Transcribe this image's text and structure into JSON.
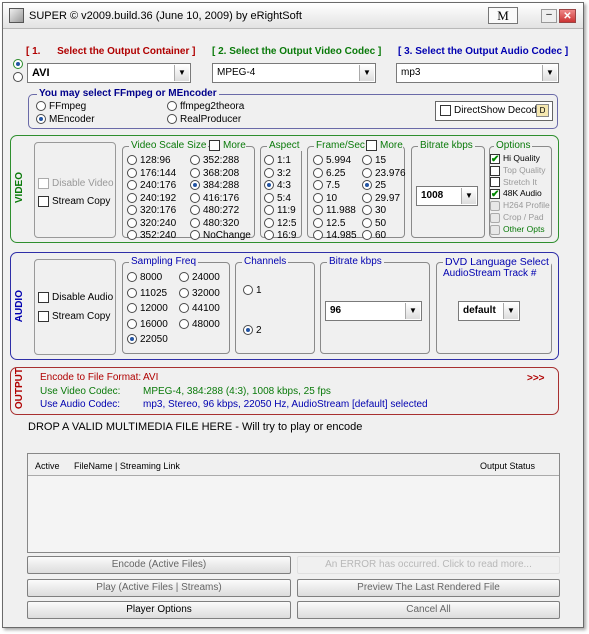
{
  "window": {
    "title": "SUPER © v2009.build.36 (June 10, 2009) by eRightSoft",
    "m_button": "M",
    "minimize": "–",
    "close": "✕"
  },
  "header": {
    "container_label": "Select the Output Container ]",
    "container_num": "[ 1.",
    "video_codec_label": "2.  Select the Output Video Codec ]",
    "video_codec_num": "[",
    "audio_codec_label": "3.  Select the Output Audio Codec ]",
    "audio_codec_num": "[",
    "container_value": "AVI",
    "video_codec_value": "MPEG-4",
    "audio_codec_value": "mp3"
  },
  "encoder": {
    "title": "You may select FFmpeg or MEncoder",
    "options": [
      "FFmpeg",
      "ffmpeg2theora",
      "MEncoder",
      "RealProducer"
    ],
    "selected": "MEncoder",
    "directshow": "DirectShow Decode"
  },
  "video": {
    "section": "VIDEO",
    "disable": "Disable Video",
    "stream_copy": "Stream Copy",
    "scale_title": "Video Scale Size",
    "scale_more": "More",
    "scale_col1": [
      "128:96",
      "176:144",
      "240:176",
      "240:192",
      "320:176",
      "320:240",
      "352:240"
    ],
    "scale_col2": [
      "352:288",
      "368:208",
      "384:288",
      "416:176",
      "480:272",
      "480:320",
      "NoChange"
    ],
    "scale_selected": "384:288",
    "aspect_title": "Aspect",
    "aspect": [
      "1:1",
      "3:2",
      "4:3",
      "5:4",
      "11:9",
      "12:5",
      "16:9"
    ],
    "aspect_selected": "4:3",
    "fps_title": "Frame/Sec",
    "fps_more": "More",
    "fps_col1": [
      "5.994",
      "6.25",
      "7.5",
      "10",
      "11.988",
      "12.5",
      "14.985"
    ],
    "fps_col2": [
      "15",
      "23.976",
      "25",
      "29.97",
      "30",
      "50",
      "60"
    ],
    "fps_selected": "25",
    "bitrate_title": "Bitrate  kbps",
    "bitrate_value": "1008",
    "options_title": "Options",
    "options": [
      "Hi Quality",
      "Top Quality",
      "Stretch It",
      "48K Audio",
      "H264 Profile",
      "Crop / Pad",
      "Other Opts"
    ]
  },
  "audio": {
    "section": "AUDIO",
    "disable": "Disable Audio",
    "stream_copy": "Stream Copy",
    "freq_title": "Sampling Freq",
    "freq_col1": [
      "8000",
      "11025",
      "12000",
      "16000",
      "22050"
    ],
    "freq_col2": [
      "24000",
      "32000",
      "44100",
      "48000"
    ],
    "freq_selected": "22050",
    "channels_title": "Channels",
    "channels": [
      "1",
      "2"
    ],
    "channels_selected": "2",
    "bitrate_title": "Bitrate  kbps",
    "bitrate_value": "96",
    "dvd_title": "DVD Language Select",
    "dvd_sub": "AudioStream  Track #",
    "dvd_value": "default"
  },
  "output": {
    "section": "OUTPUT",
    "format_label": "Encode to File Format:",
    "format_value": "AVI",
    "more": ">>>",
    "vcodec_label": "Use Video Codec:",
    "vcodec_value": "MPEG-4,  384:288 (4:3),  1008 kbps,  25 fps",
    "acodec_label": "Use Audio Codec:",
    "acodec_value": "mp3,  Stereo,  96 kbps,  22050 Hz,  AudioStream [default] selected"
  },
  "drop_text": "DROP A VALID MULTIMEDIA FILE HERE - Will try to play or encode",
  "filelist": {
    "col_active": "Active",
    "col_filename": "FileName  |  Streaming Link",
    "col_status": "Output Status"
  },
  "buttons": {
    "encode": "Encode (Active Files)",
    "error": "An ERROR has occurred. Click to read more...",
    "play": "Play (Active Files | Streams)",
    "preview": "Preview The Last Rendered File",
    "player_options": "Player Options",
    "cancel_all": "Cancel All"
  }
}
